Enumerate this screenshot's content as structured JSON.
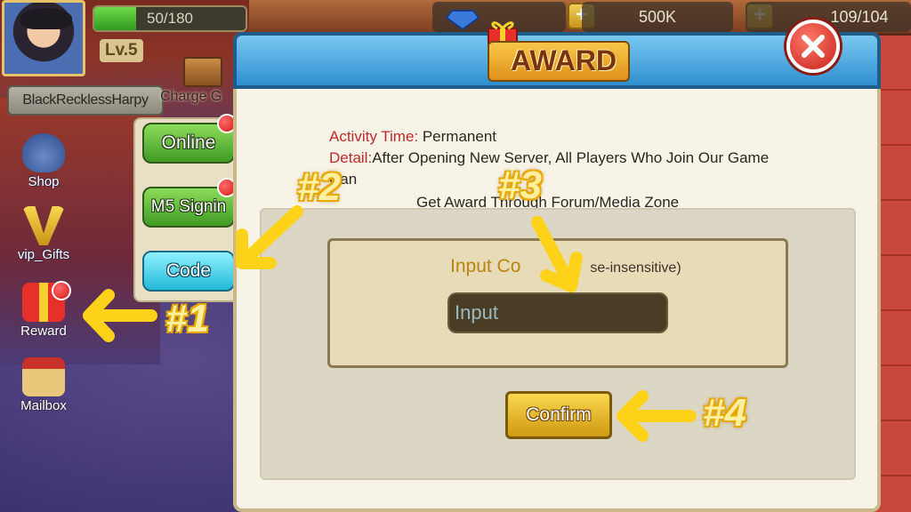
{
  "hud": {
    "hp_text": "50/180",
    "hp_fraction": 0.278,
    "level": "Lv.5",
    "username": "BlackRecklessHarpy",
    "charge_label": "Charge G"
  },
  "resources": {
    "gold": "500K",
    "stamina": "109/104"
  },
  "side_menu": [
    {
      "label": "Shop",
      "icon": "money-bag-icon"
    },
    {
      "label": "vip_Gifts",
      "icon": "vip-icon"
    },
    {
      "label": "Reward",
      "icon": "gift-box-icon"
    },
    {
      "label": "Mailbox",
      "icon": "mailbox-icon"
    }
  ],
  "menu_buttons": {
    "online": "Online",
    "signin": "M5 Signin",
    "code": "Code"
  },
  "dialog": {
    "title": "AWARD",
    "activity_label": "Activity Time:",
    "activity_value": " Permanent",
    "detail_label": "Detail:",
    "detail_value": "After Opening New Server, All Players Who Join Our Game",
    "detail_cont": "Can",
    "note": "Get Award Through Forum/Media Zone",
    "input_label": "Input Co",
    "input_label_rest": "se-insensitive)",
    "input_placeholder": "Input",
    "confirm": "Confirm"
  },
  "annotations": {
    "step1": "#1",
    "step2": "#2",
    "step3": "#3",
    "step4": "#4"
  },
  "colors": {
    "annotation_arrow": "#ffd21a",
    "header_blue": "#2f8fd0",
    "confirm_gold": "#d09a10"
  }
}
